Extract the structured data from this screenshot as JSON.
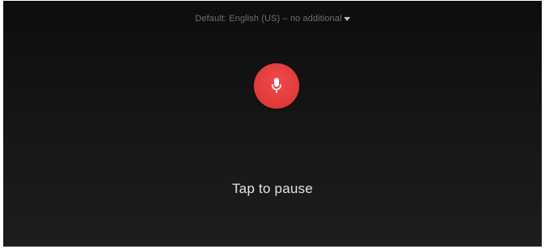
{
  "language_selector": {
    "label": "Default: English (US) – no additional",
    "icon": "chevron-down-icon"
  },
  "mic_button": {
    "icon": "microphone-icon",
    "color": "#e23c3c"
  },
  "status": {
    "text": "Tap to pause"
  }
}
